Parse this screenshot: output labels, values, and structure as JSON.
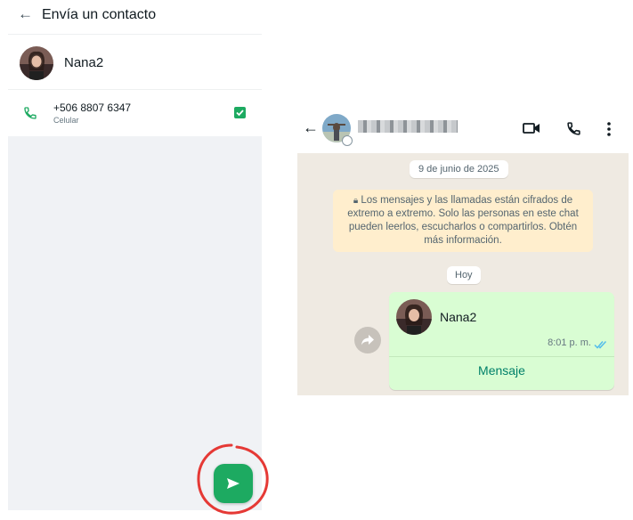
{
  "send_contact": {
    "title": "Envía un contacto",
    "contact_name": "Nana2",
    "phone": "+506 8807 6347",
    "phone_type": "Celular",
    "selected": true
  },
  "chat": {
    "date": "9 de junio de 2025",
    "encryption_notice": "Los mensajes y las llamadas están cifrados de extremo a extremo. Solo las personas en este chat pueden leerlos, escucharlos o compartirlos. Obtén más información.",
    "today": "Hoy",
    "contact_card": {
      "name": "Nana2",
      "time": "8:01 p. m.",
      "action": "Mensaje"
    }
  },
  "colors": {
    "whatsapp_green": "#1daa61",
    "bubble_green": "#d9fdd3",
    "link_green": "#008069",
    "annotation_red": "#e53935"
  },
  "icons": [
    "back-arrow-icon",
    "phone-icon",
    "checkbox-checked-icon",
    "send-icon",
    "video-call-icon",
    "voice-call-icon",
    "more-vert-icon",
    "lock-icon",
    "forward-icon",
    "double-check-icon"
  ]
}
